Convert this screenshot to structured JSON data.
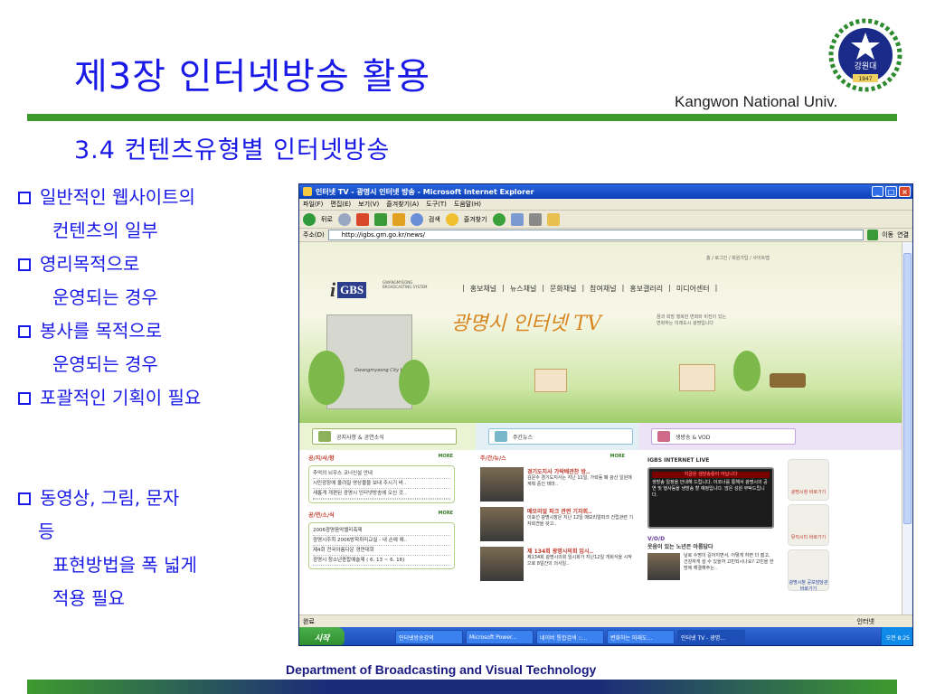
{
  "slide": {
    "title": "제3장 인터넷방송 활용",
    "subtitle": "3.4 컨텐츠유형별 인터넷방송",
    "univ_name": "Kangwon National Univ.",
    "logo_text": "강원대",
    "logo_year": "1947",
    "footer": "Department of  Broadcasting and Visual Technology",
    "bullets": [
      {
        "line1": "일반적인 웹사이트의",
        "line2": "컨텐츠의 일부"
      },
      {
        "line1": "영리목적으로",
        "line2": "운영되는 경우"
      },
      {
        "line1": "봉사를 목적으로",
        "line2": "운영되는 경우"
      },
      {
        "line1": "포괄적인 기획이 필요",
        "line2": ""
      },
      {
        "line1": "동영상, 그림, 문자",
        "line2": "등",
        "line3": "표현방법을 폭 넓게",
        "line4": "적용 필요"
      }
    ],
    "colors": {
      "title": "#1a1ae6",
      "rule": "#3e9a2e"
    }
  },
  "browser": {
    "title": "인터넷 TV - 광명시 인터넷 방송 - Microsoft Internet Explorer",
    "menu": [
      "파일(F)",
      "편집(E)",
      "보기(V)",
      "즐겨찾기(A)",
      "도구(T)",
      "도움말(H)"
    ],
    "toolbar": {
      "back": "뒤로",
      "search": "검색",
      "favorites": "즐겨찾기"
    },
    "address_label": "주소(D)",
    "address": "http://igbs.gm.go.kr/news/",
    "go_label": "이동",
    "links_label": "연결",
    "status": "완료",
    "zone": "인터넷"
  },
  "site": {
    "logo": "i",
    "logo_gbs": "GBS",
    "logo_sub": "GWANGMYEONG BROADCASTING SYSTEM",
    "top_links": "홈 / 로그인 / 회원가입 / 사이트맵",
    "nav": [
      "홍보채널",
      "뉴스채널",
      "문화채널",
      "참여채널",
      "홍보갤러리",
      "미디어센터"
    ],
    "hero_title": "광명시 인터넷 TV",
    "hero_tag": "꿈과 희망 행복한 변화와 비전이 있는 변화하는 미래도시 광명입니다",
    "city_hall": "Gwangmyeong City Hall",
    "tabs": [
      "공지사항 & 공연소식",
      "주간뉴스",
      "생방송 & VOD"
    ],
    "notice": {
      "head": "공/지/사/항",
      "more": "MORE",
      "items": [
        "추억의 뇌우스 코너신설 안내",
        "시민광장에 올려질 영상물을 보내 주시기 바..",
        "새롭게 개편된 광명시 인터넷방송에 오신 것..",
        ""
      ]
    },
    "events": {
      "head": "공/연/소/식",
      "more": "MORE",
      "items": [
        "2006광명음악밸리축제",
        "광명시주최 2006방학취미교실 - 내 손에 예..",
        "제4회 전국아름다운 경연대회",
        "광명시 청소년종합예술제 ( 6. 13 ~ 6. 16)"
      ]
    },
    "news": {
      "head": "주/간/뉴/스",
      "more": "MORE",
      "items": [
        {
          "title": "경기도지사 가락배관찬 방..",
          "body": "김문수 경기도지사는 지난 11일, 가락동 폐 광산 일원에 계획 중인 테마.."
        },
        {
          "title": "메모리얼 파크 관련 기자회..",
          "body": "이효선 광명시장은 지난 12일 메모리얼파크 건립관련 기자회견을 갖고.."
        },
        {
          "title": "제 134회 광명시의회 임시..",
          "body": "제134회 광명시의회 임시회가 지난12일 개회식을 시작으로 8일간의 의사일.."
        }
      ]
    },
    "live": {
      "head": "IGBS INTERNET LIVE",
      "banner": "지금은 생방송중이 아닙니다",
      "body": "생방송 일정을 안내해 드립니다. 이코너를 통해서 광명시의 공연 및 행사등을 생방송 할 예정입니다. 많은 성원 부탁드립니다.",
      "vod_head": "V/O/D",
      "vod_title": "웃음이 있는 노년은 아름답다",
      "vod_body": "날로 수명이 길어지면서, 어떻게 하면 더 젊고, 건강하게 살 수 있을까 고민되시나요? 고민을 한방에 해결해주는.."
    },
    "side_buttons": [
      "광명시청 바로가기",
      "뮤직시티 바로가기",
      "광명시청 공보담당관 바로가기"
    ]
  },
  "taskbar": {
    "start": "시작",
    "tasks": [
      "인터넷방송강의",
      "Microsoft Power...",
      "네이버 통합검색 ::...",
      "변화하는 미래도...",
      "인터넷 TV - 광명..."
    ],
    "clock": "오전 8:25"
  }
}
